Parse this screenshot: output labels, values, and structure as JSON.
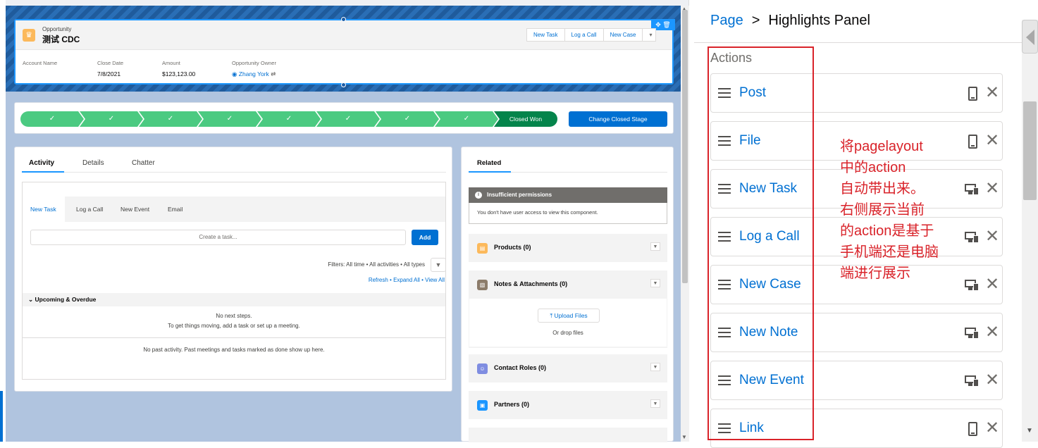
{
  "record": {
    "object_type": "Opportunity",
    "name": "测试 CDC",
    "actions": [
      "New Task",
      "Log a Call",
      "New Case"
    ],
    "fields": [
      {
        "label": "Account Name",
        "value": ""
      },
      {
        "label": "Close Date",
        "value": "7/8/2021"
      },
      {
        "label": "Amount",
        "value": "$123,123.00"
      },
      {
        "label": "Opportunity Owner",
        "value": "Zhang York"
      }
    ]
  },
  "path": {
    "steps": [
      "✓",
      "✓",
      "✓",
      "✓",
      "✓",
      "✓",
      "✓",
      "✓",
      "✓"
    ],
    "current": "Closed Won",
    "button": "Change Closed Stage"
  },
  "activity": {
    "tabs": [
      "Activity",
      "Details",
      "Chatter"
    ],
    "subtabs": [
      "New Task",
      "Log a Call",
      "New Event",
      "Email"
    ],
    "task_placeholder": "Create a task...",
    "add_label": "Add",
    "filters": "Filters: All time • All activities • All types",
    "links": "Refresh • Expand All • View All",
    "upcoming": "Upcoming & Overdue",
    "no_steps": "No next steps.",
    "no_steps_hint": "To get things moving, add a task or set up a meeting.",
    "no_past": "No past activity. Past meetings and tasks marked as done show up here."
  },
  "related": {
    "tab": "Related",
    "error_title": "Insufficient permissions",
    "error_body": "You don't have user access to view this component.",
    "lists": [
      {
        "title": "Products (0)",
        "color": "#fcb95b"
      },
      {
        "title": "Notes & Attachments (0)",
        "color": "#8c7c6a"
      },
      {
        "title": "Contact Roles (0)",
        "color": "#7f8de1"
      },
      {
        "title": "Partners (0)",
        "color": "#1b96ff"
      }
    ],
    "upload": "Upload Files",
    "drop": "Or drop files"
  },
  "panel": {
    "crumb_page": "Page",
    "crumb_sep": ">",
    "crumb_current": "Highlights Panel",
    "section": "Actions",
    "items": [
      {
        "label": "Post",
        "device": "phone"
      },
      {
        "label": "File",
        "device": "phone"
      },
      {
        "label": "New Task",
        "device": "desktop-phone"
      },
      {
        "label": "Log a Call",
        "device": "desktop-phone"
      },
      {
        "label": "New Case",
        "device": "desktop-phone"
      },
      {
        "label": "New Note",
        "device": "desktop-phone"
      },
      {
        "label": "New Event",
        "device": "desktop-phone"
      },
      {
        "label": "Link",
        "device": "phone"
      }
    ],
    "remove_glyph": "✕"
  },
  "annotation": "将pagelayout\n中的action\n自动带出来。\n右侧展示当前\n的action是基于\n手机端还是电脑\n端进行展示",
  "colors": {
    "brand": "#0070d2",
    "annotation": "#d9232a",
    "path_complete": "#4bca81",
    "path_current": "#04844b"
  }
}
